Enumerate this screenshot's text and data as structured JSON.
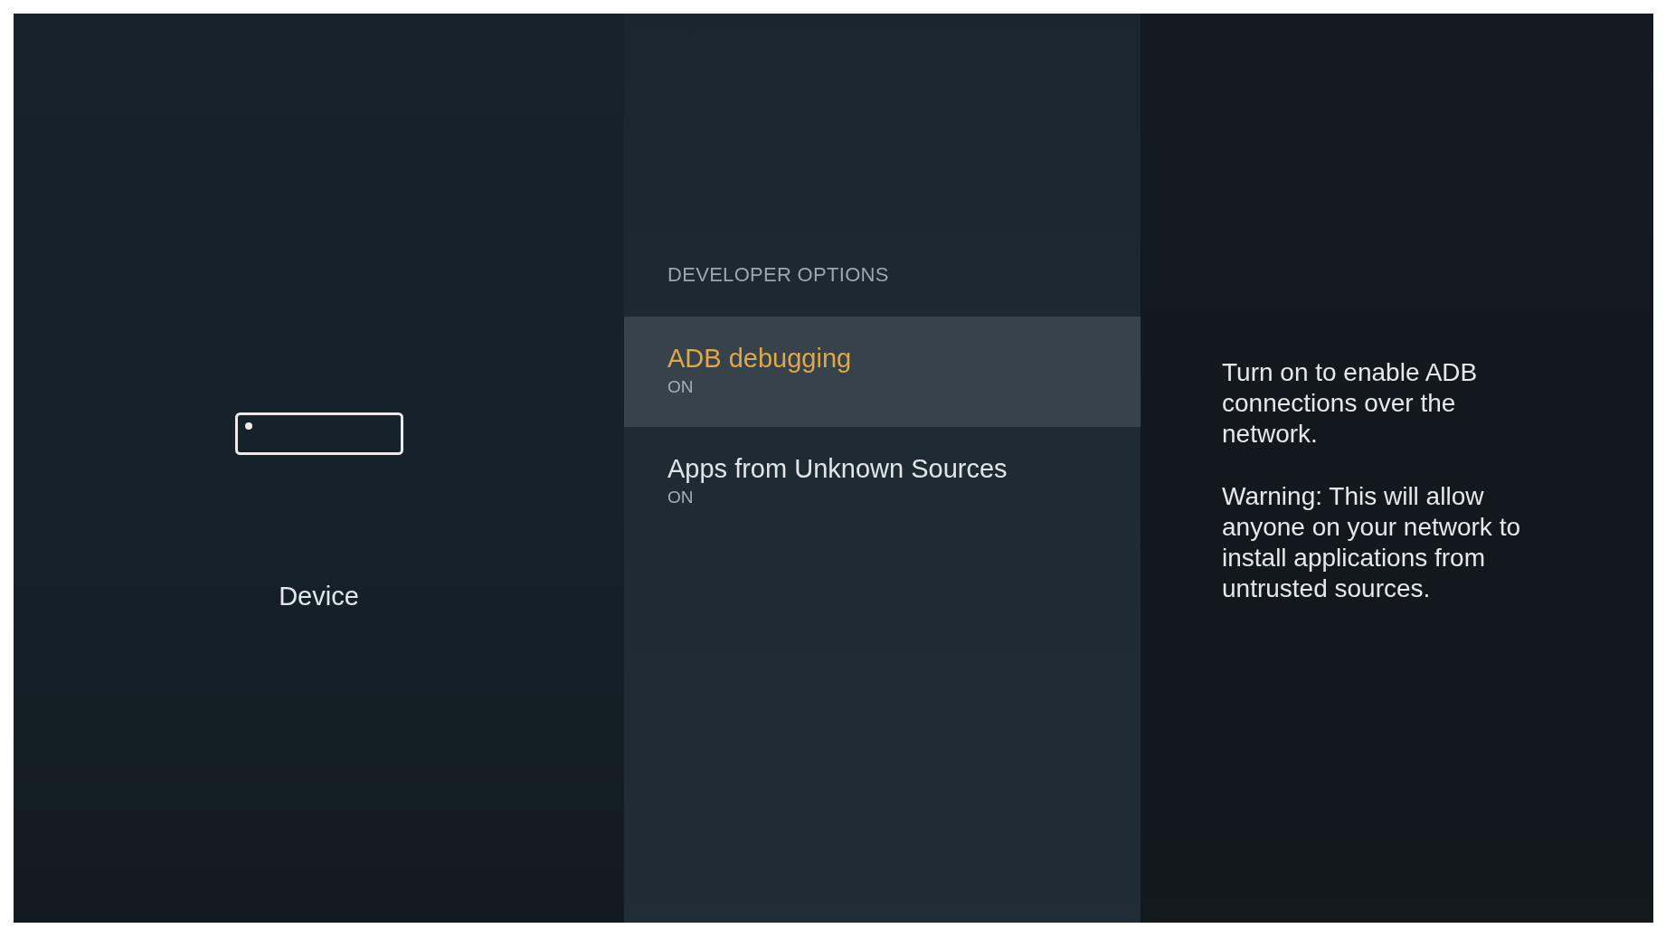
{
  "category": {
    "label": "Device"
  },
  "menu": {
    "heading": "DEVELOPER OPTIONS",
    "items": [
      {
        "label": "ADB debugging",
        "value": "ON",
        "selected": true
      },
      {
        "label": "Apps from Unknown Sources",
        "value": "ON",
        "selected": false
      }
    ]
  },
  "description": {
    "paragraphs": [
      "Turn on to enable ADB connections over the network.",
      "Warning: This will allow anyone on your network to install applications from untrusted sources."
    ]
  }
}
